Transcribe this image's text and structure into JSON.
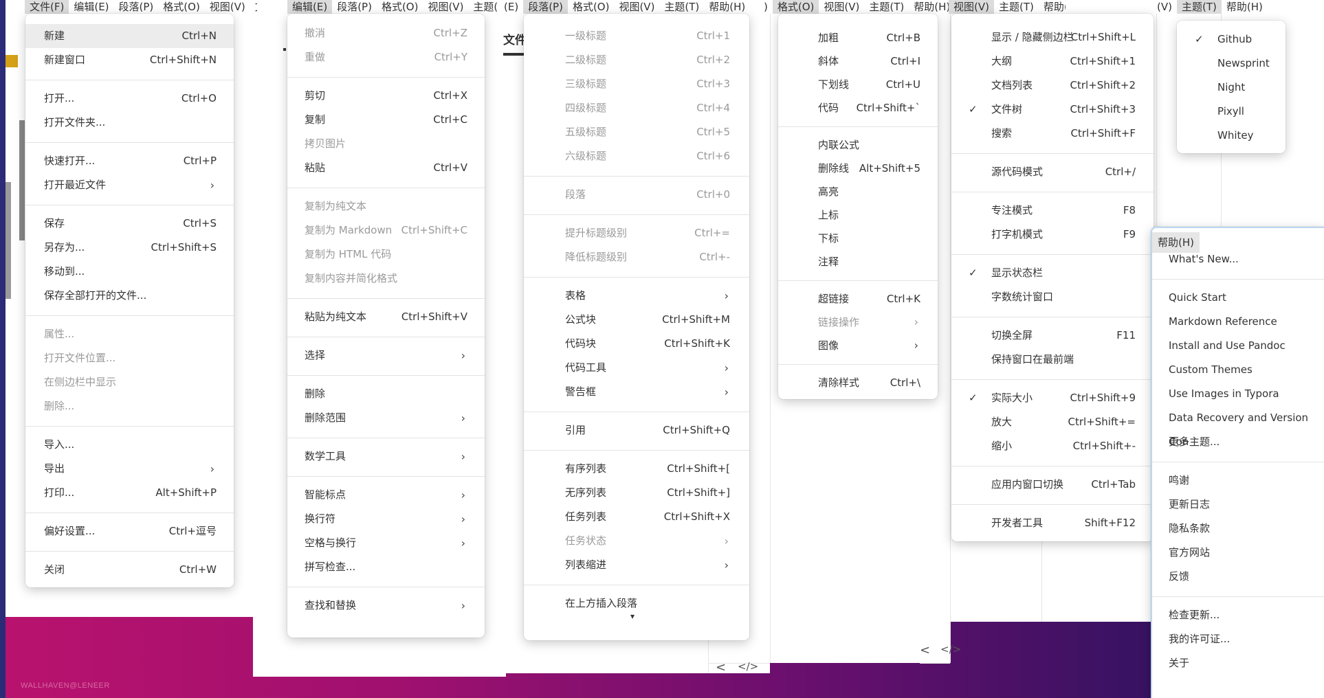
{
  "watermark": "WALLHAVEN@LENEER",
  "menubars": [
    {
      "items": [
        "文件(F)",
        "编辑(E)",
        "段落(P)",
        "格式(O)",
        "视图(V)",
        "文件(F)"
      ],
      "active": 0
    },
    {
      "items": [
        "编辑(E)",
        "段落(P)",
        "格式(O)",
        "视图(V)",
        "主题("
      ],
      "active": 0
    },
    {
      "items": [
        "(E)",
        "段落(P)",
        "格式(O)",
        "视图(V)",
        "主题(T)",
        "帮助(H)"
      ],
      "active": 1
    },
    {
      "items": [
        ")",
        "格式(O)",
        "视图(V)",
        "主题(T)",
        "帮助(H)"
      ],
      "active": 1
    },
    {
      "items": [
        "视图(V)",
        "主题(T)",
        "帮助(H)"
      ],
      "active": 0
    },
    {
      "items": [
        "(V)",
        "主题(T)",
        "帮助(H)"
      ],
      "active": 1
    }
  ],
  "doc_tab_label": "文件",
  "nav": {
    "left": "<",
    "code": "</>"
  },
  "file_menu": {
    "groups": [
      [
        {
          "label": "新建",
          "shortcut": "Ctrl+N",
          "highlighted": true
        },
        {
          "label": "新建窗口",
          "shortcut": "Ctrl+Shift+N"
        }
      ],
      [
        {
          "label": "打开...",
          "shortcut": "Ctrl+O"
        },
        {
          "label": "打开文件夹..."
        }
      ],
      [
        {
          "label": "快速打开...",
          "shortcut": "Ctrl+P"
        },
        {
          "label": "打开最近文件",
          "submenu": true
        }
      ],
      [
        {
          "label": "保存",
          "shortcut": "Ctrl+S"
        },
        {
          "label": "另存为...",
          "shortcut": "Ctrl+Shift+S"
        },
        {
          "label": "移动到..."
        },
        {
          "label": "保存全部打开的文件..."
        }
      ],
      [
        {
          "label": "属性...",
          "disabled": true
        },
        {
          "label": "打开文件位置...",
          "disabled": true
        },
        {
          "label": "在侧边栏中显示",
          "disabled": true
        },
        {
          "label": "删除...",
          "disabled": true
        }
      ],
      [
        {
          "label": "导入..."
        },
        {
          "label": "导出",
          "submenu": true
        },
        {
          "label": "打印...",
          "shortcut": "Alt+Shift+P"
        }
      ],
      [
        {
          "label": "偏好设置...",
          "shortcut": "Ctrl+逗号"
        }
      ],
      [
        {
          "label": "关闭",
          "shortcut": "Ctrl+W"
        }
      ]
    ]
  },
  "edit_menu": {
    "groups": [
      [
        {
          "label": "撤消",
          "shortcut": "Ctrl+Z",
          "disabled": true
        },
        {
          "label": "重做",
          "shortcut": "Ctrl+Y",
          "disabled": true
        }
      ],
      [
        {
          "label": "剪切",
          "shortcut": "Ctrl+X"
        },
        {
          "label": "复制",
          "shortcut": "Ctrl+C"
        },
        {
          "label": "拷贝图片",
          "disabled": true
        },
        {
          "label": "粘贴",
          "shortcut": "Ctrl+V"
        }
      ],
      [
        {
          "label": "复制为纯文本",
          "disabled": true
        },
        {
          "label": "复制为 Markdown",
          "shortcut": "Ctrl+Shift+C",
          "disabled": true
        },
        {
          "label": "复制为 HTML 代码",
          "disabled": true
        },
        {
          "label": "复制内容并简化格式",
          "disabled": true
        }
      ],
      [
        {
          "label": "粘贴为纯文本",
          "shortcut": "Ctrl+Shift+V"
        }
      ],
      [
        {
          "label": "选择",
          "submenu": true
        }
      ],
      [
        {
          "label": "删除"
        },
        {
          "label": "删除范围",
          "submenu": true
        }
      ],
      [
        {
          "label": "数学工具",
          "submenu": true
        }
      ],
      [
        {
          "label": "智能标点",
          "submenu": true
        },
        {
          "label": "换行符",
          "submenu": true
        },
        {
          "label": "空格与换行",
          "submenu": true
        },
        {
          "label": "拼写检查..."
        }
      ],
      [
        {
          "label": "查找和替换",
          "submenu": true
        }
      ]
    ]
  },
  "paragraph_menu": {
    "groups": [
      [
        {
          "label": "一级标题",
          "shortcut": "Ctrl+1",
          "disabled": true
        },
        {
          "label": "二级标题",
          "shortcut": "Ctrl+2",
          "disabled": true
        },
        {
          "label": "三级标题",
          "shortcut": "Ctrl+3",
          "disabled": true
        },
        {
          "label": "四级标题",
          "shortcut": "Ctrl+4",
          "disabled": true
        },
        {
          "label": "五级标题",
          "shortcut": "Ctrl+5",
          "disabled": true
        },
        {
          "label": "六级标题",
          "shortcut": "Ctrl+6",
          "disabled": true
        }
      ],
      [
        {
          "label": "段落",
          "shortcut": "Ctrl+0",
          "disabled": true
        }
      ],
      [
        {
          "label": "提升标题级别",
          "shortcut": "Ctrl+=",
          "disabled": true
        },
        {
          "label": "降低标题级别",
          "shortcut": "Ctrl+-",
          "disabled": true
        }
      ],
      [
        {
          "label": "表格",
          "submenu": true
        },
        {
          "label": "公式块",
          "shortcut": "Ctrl+Shift+M"
        },
        {
          "label": "代码块",
          "shortcut": "Ctrl+Shift+K"
        },
        {
          "label": "代码工具",
          "submenu": true
        },
        {
          "label": "警告框",
          "submenu": true
        }
      ],
      [
        {
          "label": "引用",
          "shortcut": "Ctrl+Shift+Q"
        }
      ],
      [
        {
          "label": "有序列表",
          "shortcut": "Ctrl+Shift+["
        },
        {
          "label": "无序列表",
          "shortcut": "Ctrl+Shift+]"
        },
        {
          "label": "任务列表",
          "shortcut": "Ctrl+Shift+X"
        },
        {
          "label": "任务状态",
          "submenu": true,
          "disabled": true
        },
        {
          "label": "列表缩进",
          "submenu": true
        }
      ],
      [
        {
          "label": "在上方插入段落"
        }
      ]
    ],
    "more_indicator": "▾"
  },
  "format_menu": {
    "groups": [
      [
        {
          "label": "加粗",
          "shortcut": "Ctrl+B"
        },
        {
          "label": "斜体",
          "shortcut": "Ctrl+I"
        },
        {
          "label": "下划线",
          "shortcut": "Ctrl+U"
        },
        {
          "label": "代码",
          "shortcut": "Ctrl+Shift+`"
        }
      ],
      [
        {
          "label": "内联公式"
        },
        {
          "label": "删除线",
          "shortcut": "Alt+Shift+5"
        },
        {
          "label": "高亮"
        },
        {
          "label": "上标"
        },
        {
          "label": "下标"
        },
        {
          "label": "注释"
        }
      ],
      [
        {
          "label": "超链接",
          "shortcut": "Ctrl+K"
        },
        {
          "label": "链接操作",
          "submenu": true,
          "disabled": true
        },
        {
          "label": "图像",
          "submenu": true
        }
      ],
      [
        {
          "label": "清除样式",
          "shortcut": "Ctrl+\\"
        }
      ]
    ]
  },
  "view_menu": {
    "groups": [
      [
        {
          "label": "显示 / 隐藏侧边栏",
          "shortcut": "Ctrl+Shift+L"
        },
        {
          "label": "大纲",
          "shortcut": "Ctrl+Shift+1"
        },
        {
          "label": "文档列表",
          "shortcut": "Ctrl+Shift+2"
        },
        {
          "label": "文件树",
          "shortcut": "Ctrl+Shift+3",
          "checked": true
        },
        {
          "label": "搜索",
          "shortcut": "Ctrl+Shift+F"
        }
      ],
      [
        {
          "label": "源代码模式",
          "shortcut": "Ctrl+/"
        }
      ],
      [
        {
          "label": "专注模式",
          "shortcut": "F8"
        },
        {
          "label": "打字机模式",
          "shortcut": "F9"
        }
      ],
      [
        {
          "label": "显示状态栏",
          "checked": true
        },
        {
          "label": "字数统计窗口"
        }
      ],
      [
        {
          "label": "切换全屏",
          "shortcut": "F11"
        },
        {
          "label": "保持窗口在最前端"
        }
      ],
      [
        {
          "label": "实际大小",
          "shortcut": "Ctrl+Shift+9",
          "checked": true
        },
        {
          "label": "放大",
          "shortcut": "Ctrl+Shift+="
        },
        {
          "label": "缩小",
          "shortcut": "Ctrl+Shift+-"
        }
      ],
      [
        {
          "label": "应用内窗口切换",
          "shortcut": "Ctrl+Tab"
        }
      ],
      [
        {
          "label": "开发者工具",
          "shortcut": "Shift+F12"
        }
      ]
    ]
  },
  "theme_menu": {
    "items": [
      {
        "label": "Github",
        "checked": true
      },
      {
        "label": "Newsprint"
      },
      {
        "label": "Night"
      },
      {
        "label": "Pixyll"
      },
      {
        "label": "Whitey"
      }
    ]
  },
  "help_menu": {
    "title": "帮助(H)",
    "groups": [
      [
        {
          "label": "What's New..."
        }
      ],
      [
        {
          "label": "Quick Start"
        },
        {
          "label": "Markdown Reference"
        },
        {
          "label": "Install and Use Pandoc"
        },
        {
          "label": "Custom Themes"
        },
        {
          "label": "Use Images in Typora"
        },
        {
          "label": "Data Recovery and Version Con"
        },
        {
          "label": "更多主题..."
        }
      ],
      [
        {
          "label": "鸣谢"
        },
        {
          "label": "更新日志"
        },
        {
          "label": "隐私条款"
        },
        {
          "label": "官方网站"
        },
        {
          "label": "反馈"
        }
      ],
      [
        {
          "label": "检查更新..."
        },
        {
          "label": "我的许可证..."
        },
        {
          "label": "关于"
        }
      ]
    ]
  },
  "colors": {
    "wallpaper_gradient_start": "#b8126e",
    "wallpaper_gradient_end": "#2c1459",
    "highlight": "#ececec",
    "disabled_text": "#9a9a9a"
  }
}
